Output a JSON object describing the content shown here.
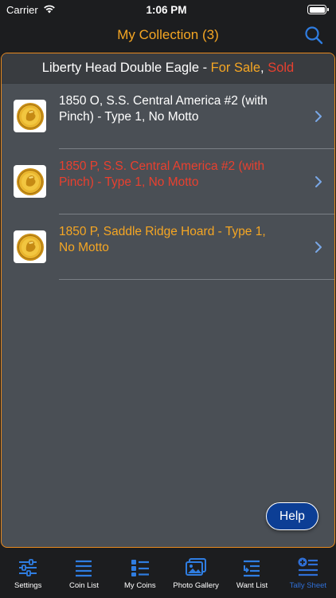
{
  "status_bar": {
    "carrier": "Carrier",
    "time": "1:06 PM"
  },
  "nav": {
    "title": "My Collection (3)"
  },
  "section": {
    "prefix": "Liberty Head Double Eagle - ",
    "for_sale": "For Sale",
    "separator": ", ",
    "sold": "Sold"
  },
  "coins": [
    {
      "line1": "1850 O, S.S. Central America #2 (with",
      "line2": "Pinch) - Type 1, No Motto",
      "status": "white"
    },
    {
      "line1": "1850 P, S.S. Central America #2 (with",
      "line2": "Pinch) - Type 1, No Motto",
      "status": "red"
    },
    {
      "line1": "1850 P, Saddle Ridge Hoard - Type 1,",
      "line2": "No Motto",
      "status": "orange"
    }
  ],
  "help_label": "Help",
  "tabs": [
    {
      "label": "Settings",
      "icon": "sliders-icon"
    },
    {
      "label": "Coin List",
      "icon": "list-icon"
    },
    {
      "label": "My Coins",
      "icon": "grid-list-icon"
    },
    {
      "label": "Photo Gallery",
      "icon": "photo-gallery-icon"
    },
    {
      "label": "Want List",
      "icon": "want-list-icon"
    },
    {
      "label": "Tally Sheet",
      "icon": "tally-sheet-icon"
    }
  ],
  "colors": {
    "accent_orange": "#f5a623",
    "sold_red": "#e8402f",
    "active_tab_blue": "#2f6fd6",
    "panel_border": "#e98a1e",
    "panel_bg": "#4a4f55"
  }
}
